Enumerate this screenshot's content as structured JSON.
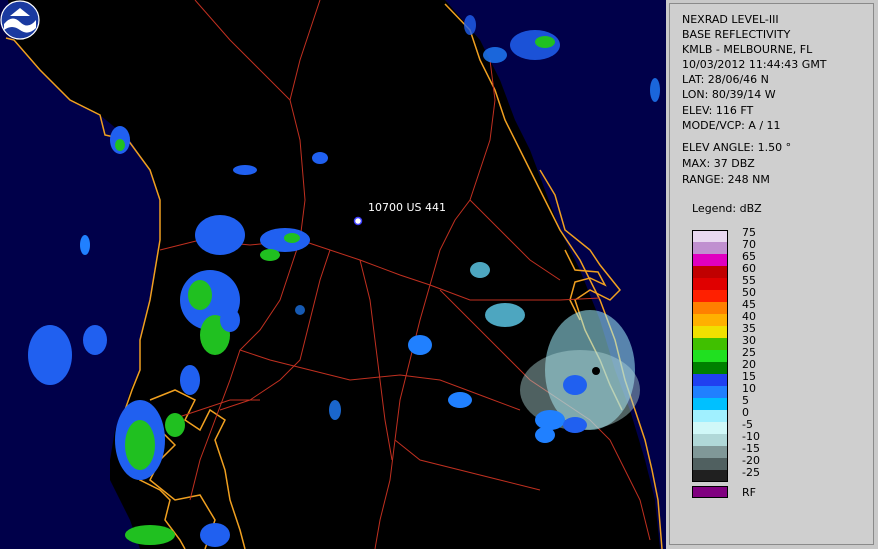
{
  "map": {
    "marker_label": "10700 US 441",
    "background": "#000000",
    "land_color": "#000000",
    "water_color": "#00004a",
    "coast_color": "#f0a020",
    "road_color": "#c03020",
    "logo": "noaa-logo-icon"
  },
  "info": {
    "lines": [
      "NEXRAD LEVEL-III",
      "BASE REFLECTIVITY",
      "KMLB - MELBOURNE, FL",
      "10/03/2012 11:44:43 GMT",
      "LAT: 28/06/46 N",
      "LON: 80/39/14 W",
      "ELEV: 116 FT",
      "MODE/VCP: A / 11"
    ],
    "elev_angle": "ELEV ANGLE: 1.50 °",
    "max": "MAX: 37 DBZ",
    "range": "RANGE: 248 NM"
  },
  "legend": {
    "title": "Legend: dBZ",
    "levels": [
      {
        "label": "75",
        "color": "#e8d8f0"
      },
      {
        "label": "70",
        "color": "#c090d0"
      },
      {
        "label": "65",
        "color": "#e000c0"
      },
      {
        "label": "60",
        "color": "#c00000"
      },
      {
        "label": "55",
        "color": "#e00000"
      },
      {
        "label": "50",
        "color": "#ff2000"
      },
      {
        "label": "45",
        "color": "#ff8000"
      },
      {
        "label": "40",
        "color": "#ffb000"
      },
      {
        "label": "35",
        "color": "#f0e000"
      },
      {
        "label": "30",
        "color": "#40c000"
      },
      {
        "label": "25",
        "color": "#20e020"
      },
      {
        "label": "20",
        "color": "#008000"
      },
      {
        "label": "15",
        "color": "#2040f0"
      },
      {
        "label": "10",
        "color": "#2080ff"
      },
      {
        "label": "5",
        "color": "#00c0ff"
      },
      {
        "label": "0",
        "color": "#a0f0ff"
      },
      {
        "label": "-5",
        "color": "#d0f8f8"
      },
      {
        "label": "-10",
        "color": "#b0d8d8"
      },
      {
        "label": "-15",
        "color": "#809898"
      },
      {
        "label": "-20",
        "color": "#506060"
      },
      {
        "label": "-25",
        "color": "#202020"
      }
    ],
    "rf_label": "RF",
    "rf_color": "#800080"
  }
}
